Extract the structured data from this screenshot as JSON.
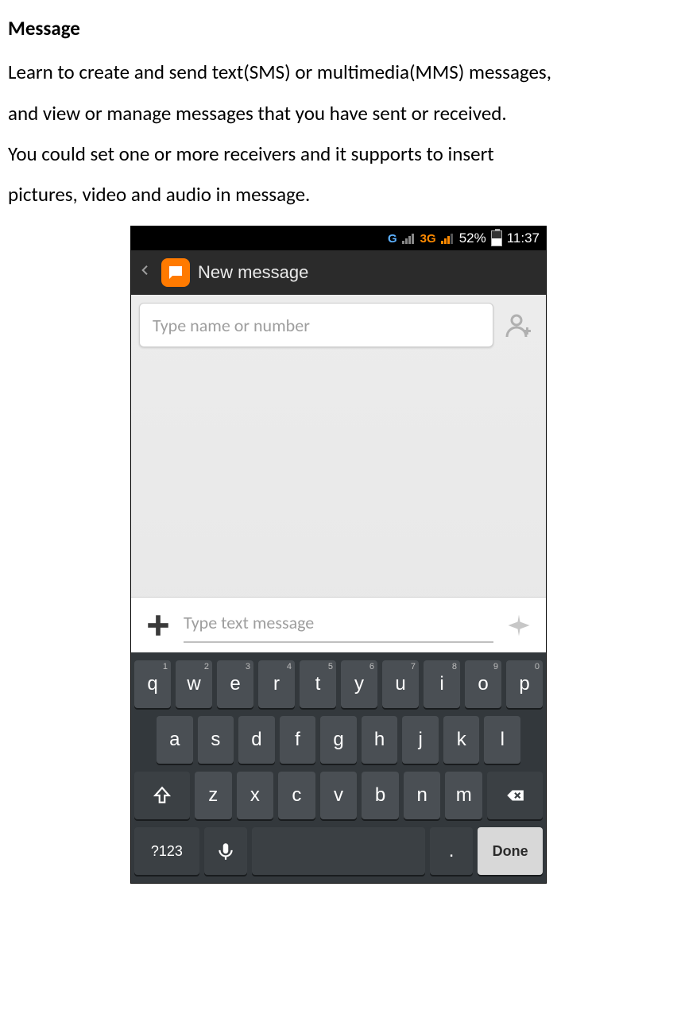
{
  "doc": {
    "heading": "Message",
    "p1": "Learn to create and send text(SMS) or multimedia(MMS) messages,",
    "p2": "and view or manage messages that you have sent or received.",
    "p3": "You could set one or more receivers and it supports to insert",
    "p4": "pictures, video and audio in message."
  },
  "status": {
    "g": "G",
    "threeg": "3G",
    "battery": "52%",
    "time": "11:37"
  },
  "actionbar": {
    "title": "New message"
  },
  "inputs": {
    "recipient_placeholder": "Type name or number",
    "message_placeholder": "Type text message"
  },
  "keyboard": {
    "row1": [
      "q",
      "w",
      "e",
      "r",
      "t",
      "y",
      "u",
      "i",
      "o",
      "p"
    ],
    "row1_alt": [
      "1",
      "2",
      "3",
      "4",
      "5",
      "6",
      "7",
      "8",
      "9",
      "0"
    ],
    "row2": [
      "a",
      "s",
      "d",
      "f",
      "g",
      "h",
      "j",
      "k",
      "l"
    ],
    "row3": [
      "z",
      "x",
      "c",
      "v",
      "b",
      "n",
      "m"
    ],
    "sym": "?123",
    "period": ".",
    "done": "Done"
  }
}
